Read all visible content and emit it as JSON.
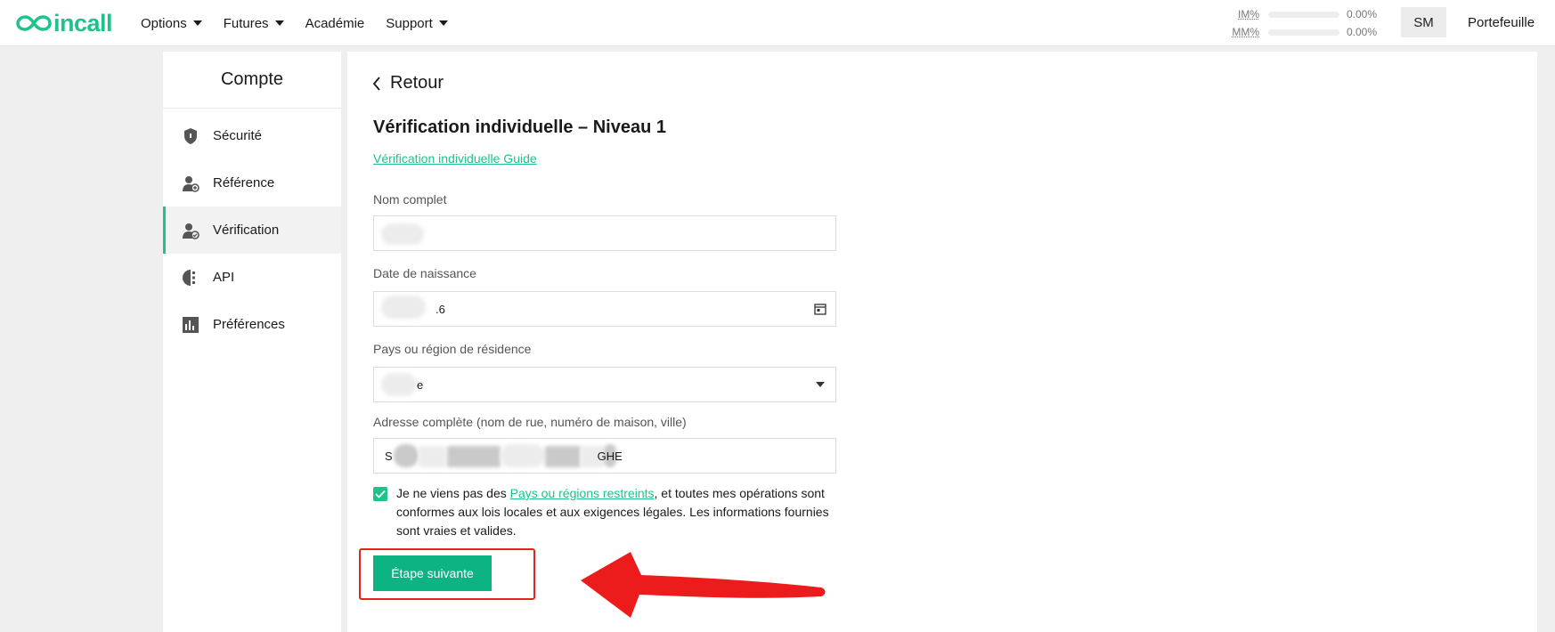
{
  "header": {
    "logo_text": "incall",
    "nav": [
      {
        "label": "Options"
      },
      {
        "label": "Futures"
      },
      {
        "label": "Académie"
      },
      {
        "label": "Support"
      }
    ],
    "margins": [
      {
        "label": "IM%",
        "value": "0.00%"
      },
      {
        "label": "MM%",
        "value": "0.00%"
      }
    ],
    "avatar_initials": "SM",
    "wallet_label": "Portefeuille"
  },
  "sidebar": {
    "title": "Compte",
    "items": [
      {
        "label": "Sécurité",
        "icon": "shield-icon"
      },
      {
        "label": "Référence",
        "icon": "user-plus-icon"
      },
      {
        "label": "Vérification",
        "icon": "user-check-icon",
        "active": true
      },
      {
        "label": "API",
        "icon": "api-icon"
      },
      {
        "label": "Préférences",
        "icon": "bar-chart-icon"
      }
    ]
  },
  "main": {
    "back_label": "Retour",
    "title": "Vérification individuelle – Niveau 1",
    "guide_link": "Vérification individuelle Guide",
    "form": {
      "full_name_label": "Nom complet",
      "full_name_value": "",
      "dob_label": "Date de naissance",
      "dob_value": ".6",
      "country_label": "Pays ou région de résidence",
      "country_value": "e",
      "address_label": "Adresse complète (nom de rue, numéro de maison, ville)",
      "address_prefix": "S",
      "address_suffix": "GHE"
    },
    "agreement": {
      "checked": true,
      "text_before": "Je ne viens pas des ",
      "link": "Pays ou régions restreints",
      "text_after": ", et toutes mes opérations sont conformes aux lois locales et aux exigences légales. Les informations fournies sont vraies et valides."
    },
    "next_button": "Étape suivante"
  },
  "colors": {
    "brand": "#1ec28b",
    "button": "#0db383",
    "annotation": "#e8231c"
  }
}
